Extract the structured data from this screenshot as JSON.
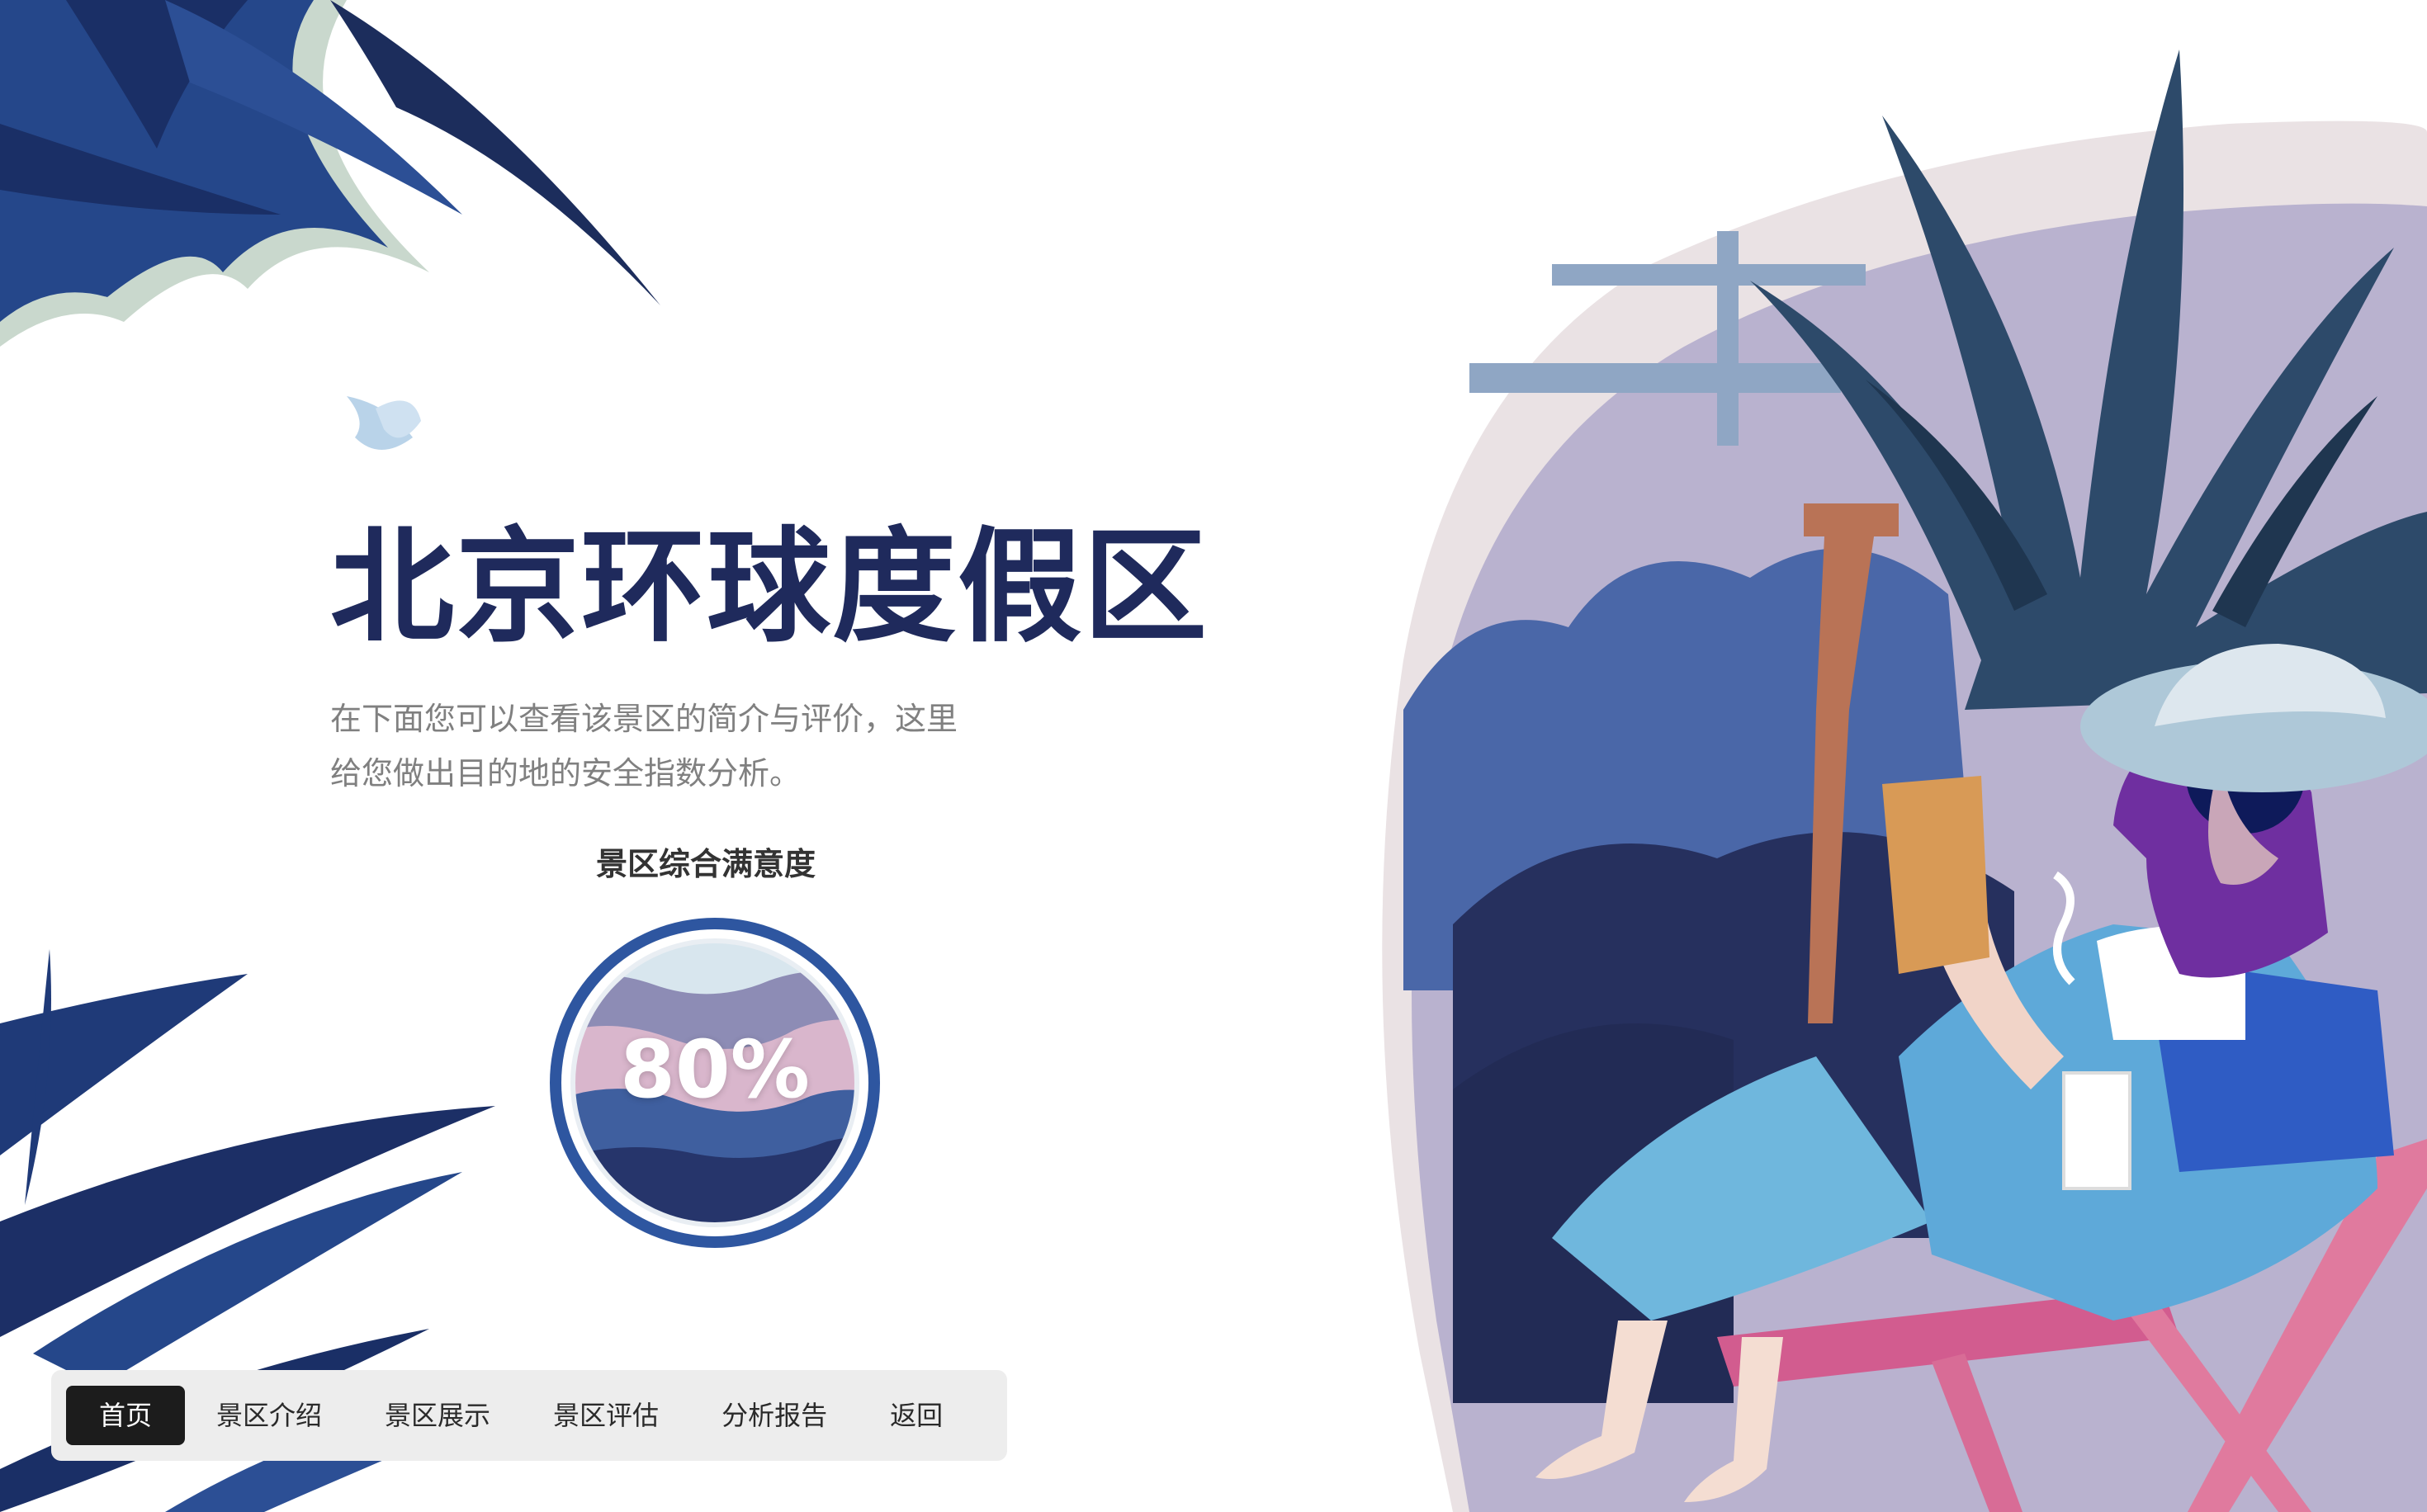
{
  "hero": {
    "title": "北京环球度假区",
    "description_line1": "在下面您可以查看该景区的简介与评价，这里",
    "description_line2": "给您做出目的地的安全指数分析。"
  },
  "satisfaction": {
    "label": "景区综合满意度",
    "value_text": "80%",
    "level": 0.8
  },
  "nav": {
    "items": [
      {
        "label": "首页",
        "active": true
      },
      {
        "label": "景区介绍",
        "active": false
      },
      {
        "label": "景区展示",
        "active": false
      },
      {
        "label": "景区评估",
        "active": false
      },
      {
        "label": "分析报告",
        "active": false
      },
      {
        "label": "返回",
        "active": false
      }
    ]
  },
  "theme": {
    "navy": "#1f2a5c",
    "ring_blue": "#2e56a0",
    "nav_active_bg": "#1c1c1c",
    "nav_bg": "#ededed"
  }
}
